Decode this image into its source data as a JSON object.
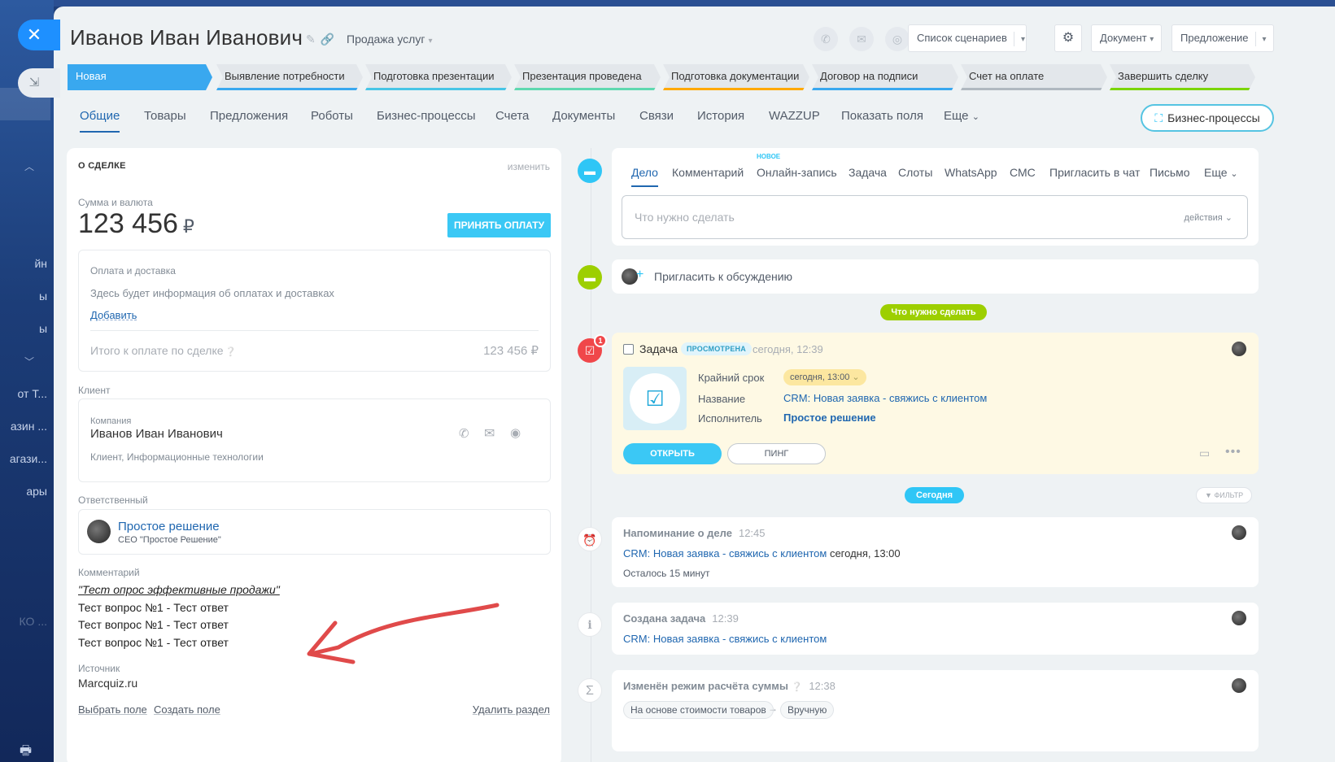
{
  "background": {
    "left_fragments": [
      "йн",
      "ы",
      "ы",
      "от Т...",
      "азин ...",
      "агази...",
      "ары",
      "КО ..."
    ]
  },
  "overlay": {
    "close_symbol": "✕",
    "minimize_symbol": "⇲"
  },
  "header": {
    "title": "Иванов Иван Иванович",
    "category": "Продажа услуг",
    "scenarios_button": "Список сценариев",
    "document_button": "Документ",
    "offer_button": "Предложение"
  },
  "stages": [
    {
      "label": "Новая",
      "color": "#39a8ef"
    },
    {
      "label": "Выявление потребности",
      "color": "#39a8ef"
    },
    {
      "label": "Подготовка презентации",
      "color": "#47c5e6"
    },
    {
      "label": "Презентация проведена",
      "color": "#5fd8b0"
    },
    {
      "label": "Подготовка документации",
      "color": "#ffa900"
    },
    {
      "label": "Договор на подписи",
      "color": "#39a8ef"
    },
    {
      "label": "Счет на оплате",
      "color": "#b0b8c0"
    },
    {
      "label": "Завершить сделку",
      "color": "#7bd500"
    }
  ],
  "tabs": [
    "Общие",
    "Товары",
    "Предложения",
    "Роботы",
    "Бизнес-процессы",
    "Счета",
    "Документы",
    "Связи",
    "История",
    "WAZZUP",
    "Показать поля",
    "Еще"
  ],
  "bp_button": "Бизнес-процессы",
  "deal": {
    "section_title": "О СДЕЛКЕ",
    "edit_link": "изменить",
    "amount_label": "Сумма и валюта",
    "amount": "123 456",
    "currency": "₽",
    "pay_button": "ПРИНЯТЬ ОПЛАТУ",
    "payment_title": "Оплата и доставка",
    "payment_info": "Здесь будет информация об оплатах и доставках",
    "add_link": "Добавить",
    "total_label": "Итого к оплате по сделке",
    "total_value": "123 456 ₽",
    "client_label": "Клиент",
    "company_label": "Компания",
    "client_name": "Иванов Иван Иванович",
    "client_desc": "Клиент, Информационные технологии",
    "responsible_label": "Ответственный",
    "responsible_name": "Простое решение",
    "responsible_role": "CEO \"Простое Решение\"",
    "comment_label": "Комментарий",
    "comment_title": "\"Тест опрос эффективные продажи\"",
    "comment_lines": [
      "Тест вопрос №1 - Тест ответ",
      "Тест вопрос №1 - Тест ответ",
      "Тест вопрос №1 - Тест ответ"
    ],
    "source_label": "Источник",
    "source_value": "Marcquiz.ru",
    "select_field": "Выбрать поле",
    "create_field": "Создать поле",
    "delete_section": "Удалить раздел"
  },
  "activity": {
    "tabs": [
      "Дело",
      "Комментарий",
      "Онлайн-запись",
      "Задача",
      "Слоты",
      "WhatsApp",
      "СМС",
      "Пригласить в чат",
      "Письмо",
      "Еще"
    ],
    "new_badge": "НОВОЕ",
    "placeholder": "Что нужно сделать",
    "actions": "действия",
    "invite": "Пригласить к обсуждению"
  },
  "timeline": {
    "todo_pill": "Что нужно сделать",
    "today_pill": "Сегодня",
    "filter": "ФИЛЬТР",
    "task": {
      "counter": "1",
      "title": "Задача",
      "status": "ПРОСМОТРЕНА",
      "time": "сегодня, 12:39",
      "deadline_label": "Крайний срок",
      "deadline_value": "сегодня, 13:00",
      "name_label": "Название",
      "name_value": "CRM: Новая заявка - свяжись с клиентом",
      "assignee_label": "Исполнитель",
      "assignee_value": "Простое решение",
      "open_button": "ОТКРЫТЬ",
      "ping_button": "ПИНГ"
    },
    "reminder": {
      "title": "Напоминание о деле",
      "time": "12:45",
      "link": "CRM: Новая заявка - свяжись с клиентом",
      "when": "сегодня, 13:00",
      "left": "Осталось 15 минут"
    },
    "created": {
      "title": "Создана задача",
      "time": "12:39",
      "link": "CRM: Новая заявка - свяжись с клиентом"
    },
    "mode": {
      "title": "Изменён режим расчёта суммы",
      "time": "12:38",
      "from": "На основе стоимости товаров",
      "to": "Вручную"
    }
  }
}
